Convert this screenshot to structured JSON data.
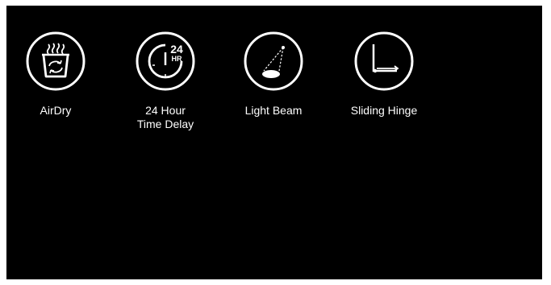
{
  "features": [
    {
      "label": "AirDry",
      "icon": "airdry-icon"
    },
    {
      "label": "24 Hour\nTime Delay",
      "icon": "24-hour-delay-icon",
      "icon_text_top": "24",
      "icon_text_bottom": "HR"
    },
    {
      "label": "Light Beam",
      "icon": "light-beam-icon"
    },
    {
      "label": "Sliding Hinge",
      "icon": "sliding-hinge-icon"
    }
  ],
  "colors": {
    "panel_background": "#000000",
    "foreground": "#ffffff",
    "page_background": "#ffffff"
  }
}
